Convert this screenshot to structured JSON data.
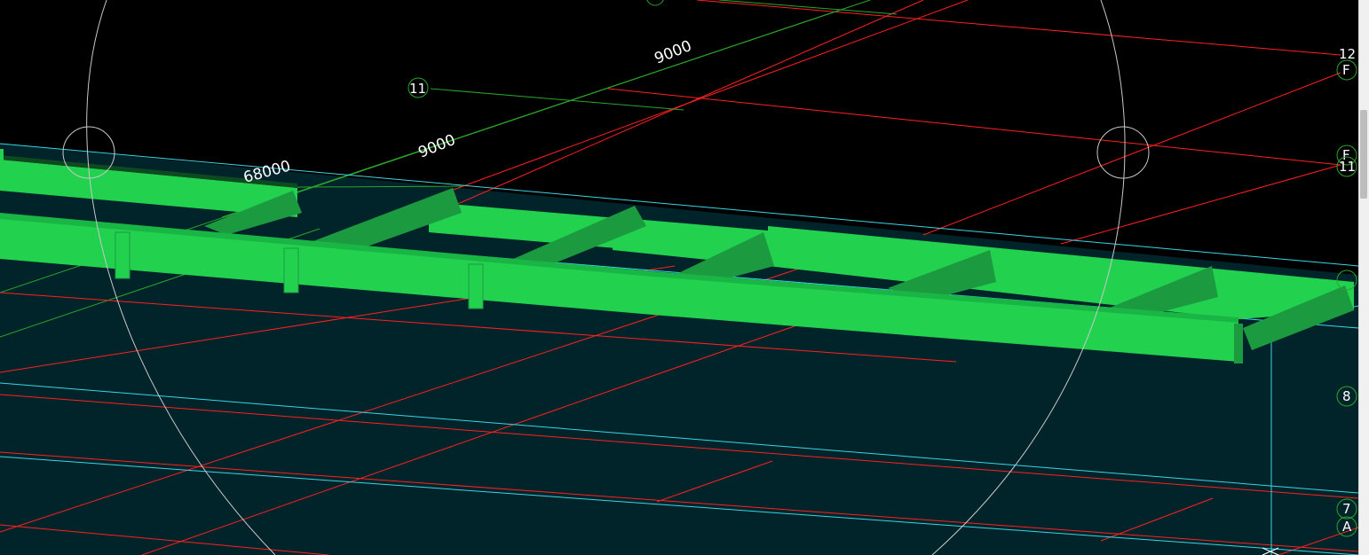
{
  "viewport": {
    "background": "#000000",
    "volume_fill": "#00242a",
    "colors": {
      "beam_top": "#22d24f",
      "beam_side": "#1c9a3f",
      "beam_dark": "#12612a",
      "grid_axis_red": "#ff2020",
      "grid_axis_green": "#2aa52a",
      "view_box_edge": "#3ad6e6",
      "orbit_circle": "#c8c8c8"
    }
  },
  "dimensions": [
    {
      "name": "dimension-9000-upper",
      "text": "9000"
    },
    {
      "name": "dimension-9000-lower",
      "text": "9000"
    },
    {
      "name": "dimension-68000",
      "text": "68000"
    }
  ],
  "grid_bubbles": [
    {
      "name": "grid-bubble-11-left",
      "text": "11"
    },
    {
      "name": "grid-bubble-12",
      "text": "12"
    },
    {
      "name": "grid-bubble-f-top",
      "text": "F"
    },
    {
      "name": "grid-bubble-f-mid",
      "text": "F"
    },
    {
      "name": "grid-bubble-11-right",
      "text": "11"
    },
    {
      "name": "grid-bubble-8",
      "text": "8"
    },
    {
      "name": "grid-bubble-7",
      "text": "7"
    },
    {
      "name": "grid-bubble-a",
      "text": "A"
    }
  ]
}
